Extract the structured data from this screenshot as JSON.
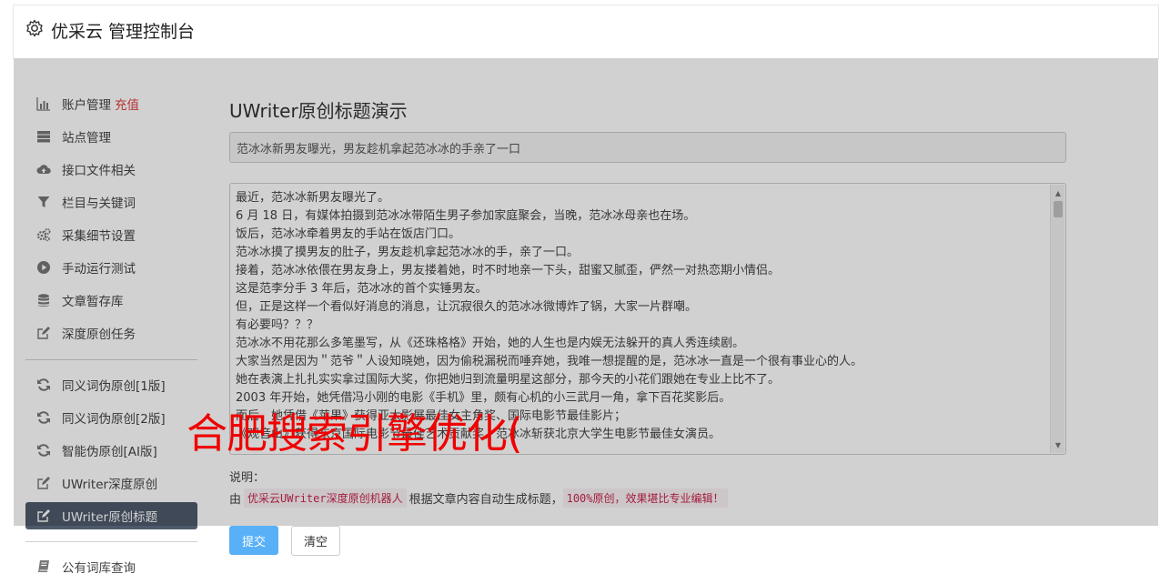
{
  "header": {
    "brand": "优采云 管理控制台",
    "icon": "gear-icon"
  },
  "sidebar": {
    "items": [
      {
        "label": "账户管理",
        "extra": "充值",
        "icon": "bar-chart-icon"
      },
      {
        "label": "站点管理",
        "icon": "server-icon"
      },
      {
        "label": "接口文件相关",
        "icon": "cloud-upload-icon"
      },
      {
        "label": "栏目与关键词",
        "icon": "filter-icon"
      },
      {
        "label": "采集细节设置",
        "icon": "gears-icon"
      },
      {
        "label": "手动运行测试",
        "icon": "play-icon"
      },
      {
        "label": "文章暂存库",
        "icon": "database-icon"
      },
      {
        "label": "深度原创任务",
        "icon": "edit-icon"
      },
      {
        "label": "同义词伪原创[1版]",
        "icon": "refresh-icon"
      },
      {
        "label": "同义词伪原创[2版]",
        "icon": "refresh-icon"
      },
      {
        "label": "智能伪原创[AI版]",
        "icon": "refresh-icon"
      },
      {
        "label": "UWriter深度原创",
        "icon": "edit-icon"
      },
      {
        "label": "UWriter原创标题",
        "icon": "edit-icon",
        "active": true
      },
      {
        "label": "公有词库查询",
        "icon": "book-icon"
      }
    ]
  },
  "main": {
    "title": "UWriter原创标题演示",
    "title_input_value": "范冰冰新男友曝光，男友趁机拿起范冰冰的手亲了一口",
    "article_lines": [
      "最近，范冰冰新男友曝光了。",
      "6 月 18 日，有媒体拍摄到范冰冰带陌生男子参加家庭聚会，当晚，范冰冰母亲也在场。",
      "饭后，范冰冰牵着男友的手站在饭店门口。",
      "范冰冰摸了摸男友的肚子，男友趁机拿起范冰冰的手，亲了一口。",
      "接着，范冰冰依偎在男友身上，男友搂着她，时不时地亲一下头，甜蜜又腻歪，俨然一对热恋期小情侣。",
      "这是范李分手 3 年后，范冰冰的首个实锤男友。",
      "但，正是这样一个看似好消息的消息，让沉寂很久的范冰冰微博炸了锅，大家一片群嘲。",
      "有必要吗？？？",
      "范冰冰不用花那么多笔墨写，从《还珠格格》开始，她的人生也是内娱无法躲开的真人秀连续剧。",
      "大家当然是因为＂范爷＂人设知晓她，因为偷税漏税而唾弃她，我唯一想提醒的是，范冰冰一直是一个很有事业心的人。",
      "她在表演上扎扎实实拿过国际大奖，你把她归到流量明星这部分，那今天的小花们跟她在专业上比不了。",
      "2003 年开始，她凭借冯小刚的电影《手机》里，颇有心机的小三武月一角，拿下百花奖影后。",
      "而后，她凭借《苹果》获得亚太影展最佳女主角奖、国际电影节最佳影片；",
      "《观音山》获得东京国际电影节最佳艺术贡献奖，范冰冰斩获北京大学生电影节最佳女演员。"
    ],
    "note_label": "说明：",
    "note_prefix": "由",
    "note_robot": "优采云UWriter深度原创机器人",
    "note_middle": "根据文章内容自动生成标题，",
    "note_highlight": "100%原创，效果堪比专业编辑！",
    "submit_label": "提交",
    "clear_label": "清空"
  },
  "watermark": "合肥搜索引擎优化("
}
